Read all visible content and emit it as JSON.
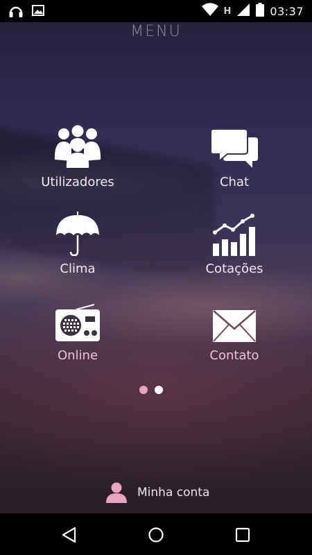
{
  "status_bar": {
    "time": "03:37",
    "network_label": "H",
    "icons": [
      "headphones-icon",
      "image-icon",
      "wifi-icon",
      "signal-icon",
      "battery-icon"
    ]
  },
  "title": "MENU",
  "menu": [
    {
      "label": "Utilizadores",
      "icon": "users-icon"
    },
    {
      "label": "Chat",
      "icon": "chat-icon"
    },
    {
      "label": "Clima",
      "icon": "umbrella-icon"
    },
    {
      "label": "Cotações",
      "icon": "stock-chart-icon"
    },
    {
      "label": "Online",
      "icon": "radio-icon"
    },
    {
      "label": "Contato",
      "icon": "envelope-icon"
    }
  ],
  "pager": {
    "pages": 2,
    "active": 1
  },
  "account": {
    "label": "Minha conta",
    "icon": "person-icon"
  },
  "colors": {
    "accent_pink": "#e7a6bd",
    "text": "#f2e8f0",
    "dot_active": "#e7a6bd",
    "dot_inactive": "#ffffff"
  }
}
